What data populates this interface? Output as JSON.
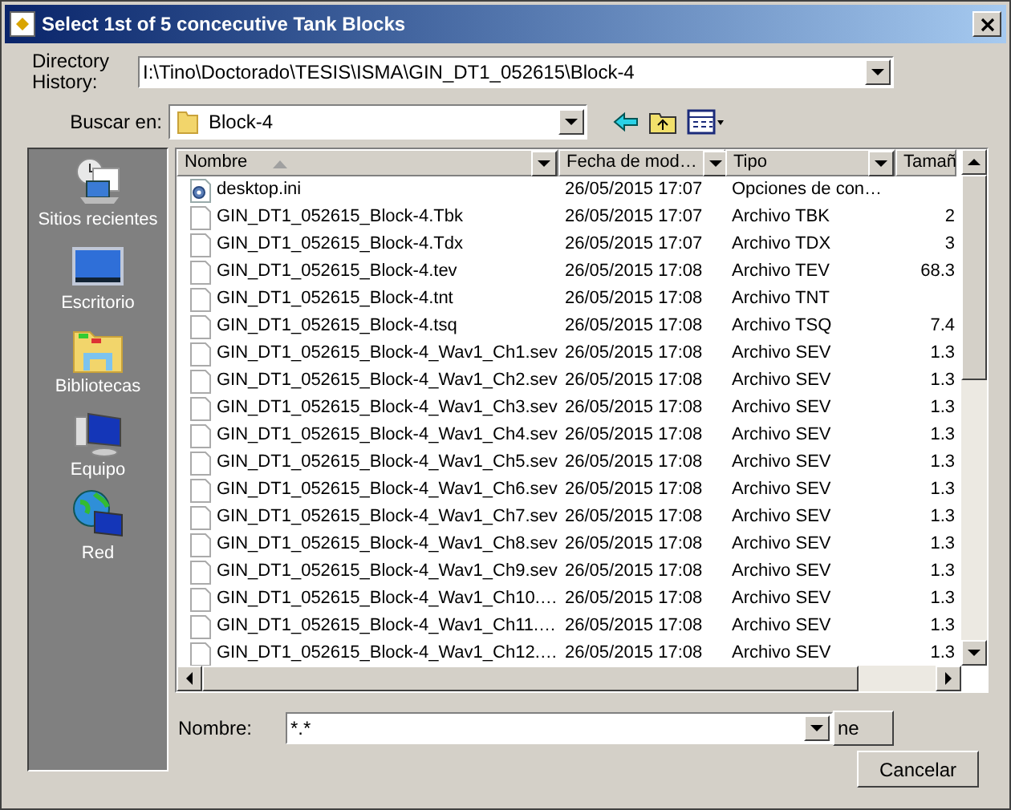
{
  "window": {
    "title": "Select 1st of 5 concecutive Tank Blocks"
  },
  "directory_history": {
    "label": "Directory History:",
    "value": "I:\\Tino\\Doctorado\\TESIS\\ISMA\\GIN_DT1_052615\\Block-4"
  },
  "look_in": {
    "label": "Buscar en:",
    "value": "Block-4"
  },
  "places": [
    {
      "label": "Sitios recientes",
      "kind": "recent"
    },
    {
      "label": "Escritorio",
      "kind": "desktop"
    },
    {
      "label": "Bibliotecas",
      "kind": "libraries"
    },
    {
      "label": "Equipo",
      "kind": "computer"
    },
    {
      "label": "Red",
      "kind": "network"
    }
  ],
  "file_list": {
    "columns": [
      "Nombre",
      "Fecha de mod…",
      "Tipo",
      "Tamañ"
    ],
    "rows": [
      {
        "kind": "settings",
        "name": "desktop.ini",
        "date": "26/05/2015 17:07",
        "type": "Opciones de con…"
      },
      {
        "kind": "file",
        "name": "GIN_DT1_052615_Block-4.Tbk",
        "date": "26/05/2015 17:07",
        "type": "Archivo TBK",
        "size": "2"
      },
      {
        "kind": "file",
        "name": "GIN_DT1_052615_Block-4.Tdx",
        "date": "26/05/2015 17:07",
        "type": "Archivo TDX",
        "size": "3"
      },
      {
        "kind": "file",
        "name": "GIN_DT1_052615_Block-4.tev",
        "date": "26/05/2015 17:08",
        "type": "Archivo TEV",
        "size": "68.3"
      },
      {
        "kind": "file",
        "name": "GIN_DT1_052615_Block-4.tnt",
        "date": "26/05/2015 17:08",
        "type": "Archivo TNT"
      },
      {
        "kind": "file",
        "name": "GIN_DT1_052615_Block-4.tsq",
        "date": "26/05/2015 17:08",
        "type": "Archivo TSQ",
        "size": "7.4"
      },
      {
        "kind": "file",
        "name": "GIN_DT1_052615_Block-4_Wav1_Ch1.sev",
        "date": "26/05/2015 17:08",
        "type": "Archivo SEV",
        "size": "1.3"
      },
      {
        "kind": "file",
        "name": "GIN_DT1_052615_Block-4_Wav1_Ch2.sev",
        "date": "26/05/2015 17:08",
        "type": "Archivo SEV",
        "size": "1.3"
      },
      {
        "kind": "file",
        "name": "GIN_DT1_052615_Block-4_Wav1_Ch3.sev",
        "date": "26/05/2015 17:08",
        "type": "Archivo SEV",
        "size": "1.3"
      },
      {
        "kind": "file",
        "name": "GIN_DT1_052615_Block-4_Wav1_Ch4.sev",
        "date": "26/05/2015 17:08",
        "type": "Archivo SEV",
        "size": "1.3"
      },
      {
        "kind": "file",
        "name": "GIN_DT1_052615_Block-4_Wav1_Ch5.sev",
        "date": "26/05/2015 17:08",
        "type": "Archivo SEV",
        "size": "1.3"
      },
      {
        "kind": "file",
        "name": "GIN_DT1_052615_Block-4_Wav1_Ch6.sev",
        "date": "26/05/2015 17:08",
        "type": "Archivo SEV",
        "size": "1.3"
      },
      {
        "kind": "file",
        "name": "GIN_DT1_052615_Block-4_Wav1_Ch7.sev",
        "date": "26/05/2015 17:08",
        "type": "Archivo SEV",
        "size": "1.3"
      },
      {
        "kind": "file",
        "name": "GIN_DT1_052615_Block-4_Wav1_Ch8.sev",
        "date": "26/05/2015 17:08",
        "type": "Archivo SEV",
        "size": "1.3"
      },
      {
        "kind": "file",
        "name": "GIN_DT1_052615_Block-4_Wav1_Ch9.sev",
        "date": "26/05/2015 17:08",
        "type": "Archivo SEV",
        "size": "1.3"
      },
      {
        "kind": "file",
        "name": "GIN_DT1_052615_Block-4_Wav1_Ch10.…",
        "date": "26/05/2015 17:08",
        "type": "Archivo SEV",
        "size": "1.3"
      },
      {
        "kind": "file",
        "name": "GIN_DT1_052615_Block-4_Wav1_Ch11.…",
        "date": "26/05/2015 17:08",
        "type": "Archivo SEV",
        "size": "1.3"
      },
      {
        "kind": "file",
        "name": "GIN_DT1_052615_Block-4_Wav1_Ch12.…",
        "date": "26/05/2015 17:08",
        "type": "Archivo SEV",
        "size": "1.3"
      }
    ]
  },
  "file_name": {
    "label": "Nombre:",
    "value": "*.*"
  },
  "buttons": [
    "ne",
    "Cancelar"
  ]
}
